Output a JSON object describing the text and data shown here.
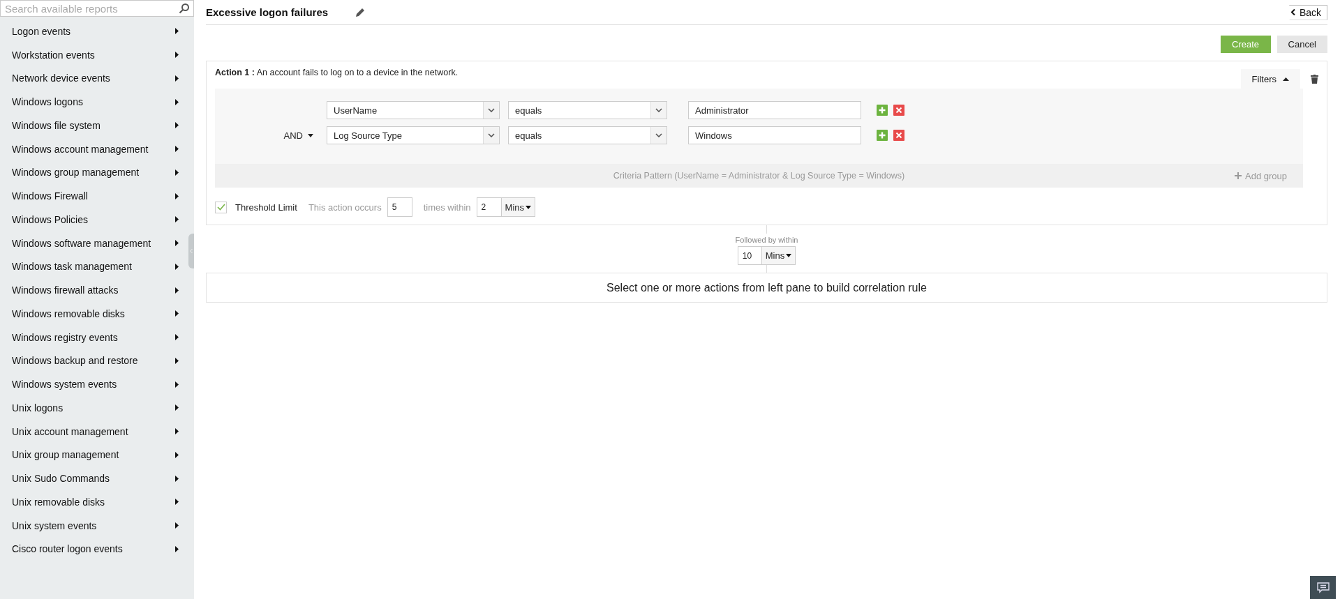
{
  "search": {
    "placeholder": "Search available reports"
  },
  "sidebar": {
    "items": [
      {
        "label": "Logon events"
      },
      {
        "label": "Workstation events"
      },
      {
        "label": "Network device events"
      },
      {
        "label": "Windows logons"
      },
      {
        "label": "Windows file system"
      },
      {
        "label": "Windows account management"
      },
      {
        "label": "Windows group management"
      },
      {
        "label": "Windows Firewall"
      },
      {
        "label": "Windows Policies"
      },
      {
        "label": "Windows software management"
      },
      {
        "label": "Windows task management"
      },
      {
        "label": "Windows firewall attacks"
      },
      {
        "label": "Windows removable disks"
      },
      {
        "label": "Windows registry events"
      },
      {
        "label": "Windows backup and restore"
      },
      {
        "label": "Windows system events"
      },
      {
        "label": "Unix logons"
      },
      {
        "label": "Unix account management"
      },
      {
        "label": "Unix group management"
      },
      {
        "label": "Unix Sudo Commands"
      },
      {
        "label": "Unix removable disks"
      },
      {
        "label": "Unix system events"
      },
      {
        "label": "Cisco router logon events"
      }
    ]
  },
  "header": {
    "title": "Excessive logon failures",
    "back": "Back"
  },
  "buttons": [
    {
      "label": "Create",
      "kind": "primary"
    },
    {
      "label": "Cancel",
      "kind": "secondary"
    }
  ],
  "action": {
    "label": "Action 1 :",
    "description": "An account fails to log on to a device in the network.",
    "filters": {
      "label": "Filters",
      "expanded": true
    },
    "conditions": [
      {
        "field": "UserName",
        "operator": "equals",
        "value": "Administrator"
      },
      {
        "join": "AND",
        "field": "Log Source Type",
        "operator": "equals",
        "value": "Windows"
      }
    ],
    "pattern": "Criteria Pattern (UserName = Administrator & Log Source Type = Windows)",
    "add_group": "Add group",
    "threshold": {
      "checked": true,
      "label": "Threshold Limit",
      "occurs_label": "This action occurs",
      "count": "5",
      "within_label": "times within",
      "duration": "2",
      "unit": "Mins"
    }
  },
  "followed": {
    "label": "Followed by within",
    "value": "10",
    "unit": "Mins"
  },
  "empty_message": "Select one or more actions from left pane to build correlation rule"
}
